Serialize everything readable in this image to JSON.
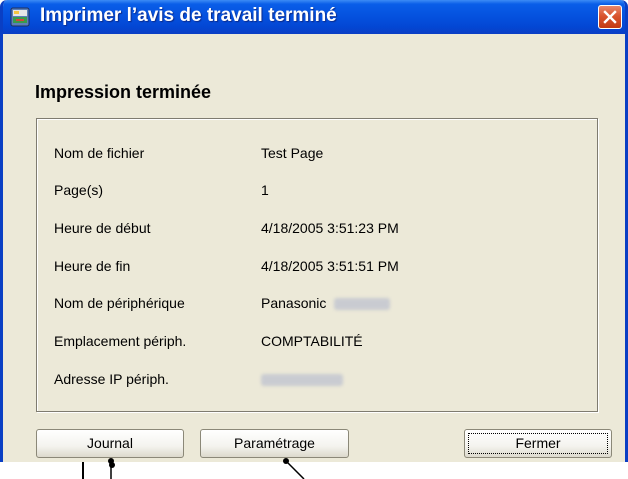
{
  "window": {
    "title": "Imprimer l’avis de travail terminé",
    "icon": "printer-app-icon",
    "close_icon": "close-icon",
    "titlebar_color": "#0552df",
    "close_color": "#d9542f",
    "body_color": "#ece9d8"
  },
  "main": {
    "heading": "Impression terminée",
    "details": [
      {
        "label": "Nom de fichier",
        "value": "Test Page"
      },
      {
        "label": "Page(s)",
        "value": "1"
      },
      {
        "label": "Heure de début",
        "value": "4/18/2005 3:51:23 PM"
      },
      {
        "label": "Heure de fin",
        "value": "4/18/2005 3:51:51 PM"
      },
      {
        "label": "Nom de périphérique",
        "value": "Panasonic"
      },
      {
        "label": "Emplacement périph.",
        "value": "COMPTABILITÉ"
      },
      {
        "label": "Adresse IP périph.",
        "value": ""
      }
    ]
  },
  "buttons": {
    "journal": "Journal",
    "parametrage": "Paramétrage",
    "fermer": "Fermer"
  }
}
